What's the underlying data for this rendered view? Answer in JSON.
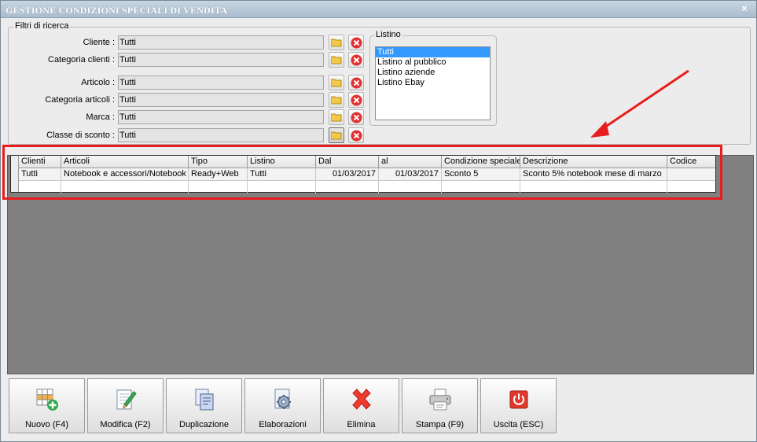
{
  "window": {
    "title": "GESTIONE CONDIZIONI SPECIALI DI VENDITA",
    "close_glyph": "×"
  },
  "filters": {
    "legend": "Filtri di ricerca",
    "rows": [
      {
        "label": "Cliente :",
        "value": "Tutti"
      },
      {
        "label": "Categoria clienti :",
        "value": "Tutti"
      },
      {
        "label": "Articolo :",
        "value": "Tutti"
      },
      {
        "label": "Categoria articoli :",
        "value": "Tutti"
      },
      {
        "label": "Marca :",
        "value": "Tutti"
      },
      {
        "label": "Classe di sconto :",
        "value": "Tutti"
      }
    ],
    "icons": {
      "browse": "folder-icon",
      "clear": "delete-icon"
    }
  },
  "listino": {
    "legend": "Listino",
    "items": [
      "Tutti",
      "Listino al pubblico",
      "Listino aziende",
      "Listino Ebay"
    ],
    "selected": "Tutti"
  },
  "grid": {
    "columns": [
      "Clienti",
      "Articoli",
      "Tipo",
      "Listino",
      "Dal",
      "al",
      "Condizione speciale",
      "Descrizione",
      "Codice"
    ],
    "rows": [
      [
        "Tutti",
        "Notebook e accessori/Notebook",
        "Ready+Web",
        "Tutti",
        "01/03/2017",
        "01/03/2017",
        "Sconto 5",
        "Sconto 5% notebook mese di marzo",
        ""
      ]
    ]
  },
  "toolbar": {
    "buttons": [
      {
        "label": "Nuovo (F4)",
        "icon": "new-grid-icon"
      },
      {
        "label": "Modifica (F2)",
        "icon": "edit-document-icon"
      },
      {
        "label": "Duplicazione",
        "icon": "duplicate-icon"
      },
      {
        "label": "Elaborazioni",
        "icon": "process-gear-icon"
      },
      {
        "label": "Elimina",
        "icon": "delete-x-icon"
      },
      {
        "label": "Stampa (F9)",
        "icon": "printer-icon"
      },
      {
        "label": "Uscita (ESC)",
        "icon": "exit-power-icon"
      }
    ]
  },
  "colors": {
    "highlight": "#e81d1d",
    "selection": "#3399ff",
    "grid_background": "#808080"
  }
}
